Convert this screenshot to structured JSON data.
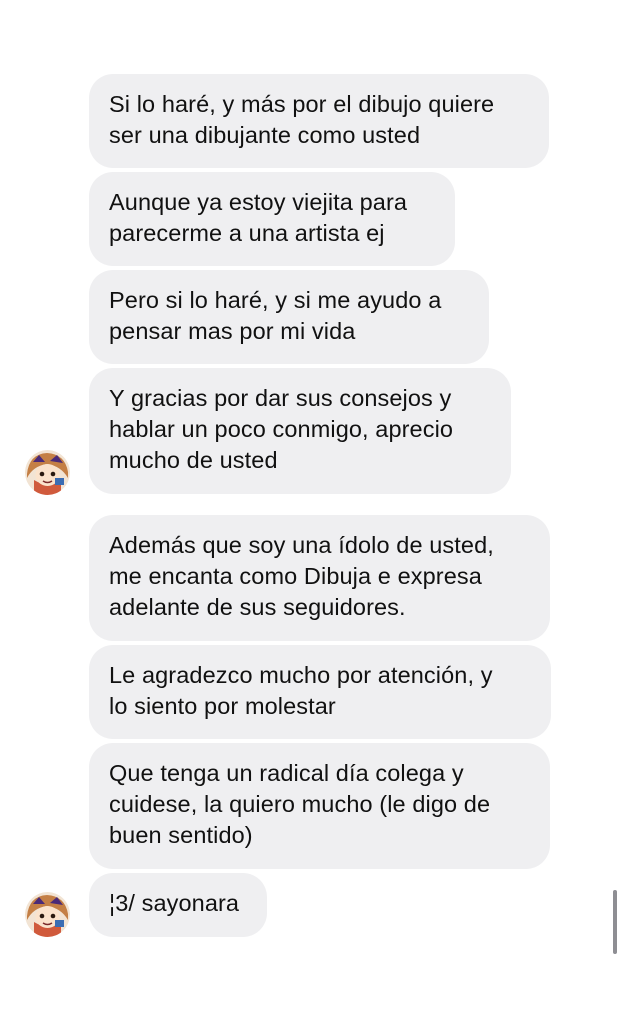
{
  "conversation": {
    "messages": [
      {
        "lines": [
          "Si lo haré, y más por el dibujo quiere",
          "ser una dibujante como usted"
        ]
      },
      {
        "lines": [
          "Aunque ya estoy viejita para",
          "parecerme a una artista ej"
        ]
      },
      {
        "lines": [
          "Pero si lo haré, y si me ayudo a",
          "pensar mas por mi vida"
        ]
      },
      {
        "lines": [
          "Y gracias por dar sus consejos y",
          "hablar un poco conmigo, aprecio",
          "mucho de usted"
        ]
      },
      {
        "lines": [
          "Además que soy una ídolo de usted,",
          "me encanta como Dibuja e expresa",
          "adelante de sus seguidores."
        ]
      },
      {
        "lines": [
          "Le agradezco mucho por atención, y",
          "lo siento por molestar"
        ]
      },
      {
        "lines": [
          "Que tenga un radical día colega y",
          "cuidese, la quiero mucho (le digo de",
          "buen sentido)"
        ]
      },
      {
        "lines": [
          "¦3/ sayonara"
        ]
      }
    ]
  },
  "colors": {
    "bubble_background": "#efeff1",
    "text": "#111111",
    "scrollbar": "#8e8e93"
  },
  "icons": {
    "avatar": "user-avatar-illustration"
  }
}
